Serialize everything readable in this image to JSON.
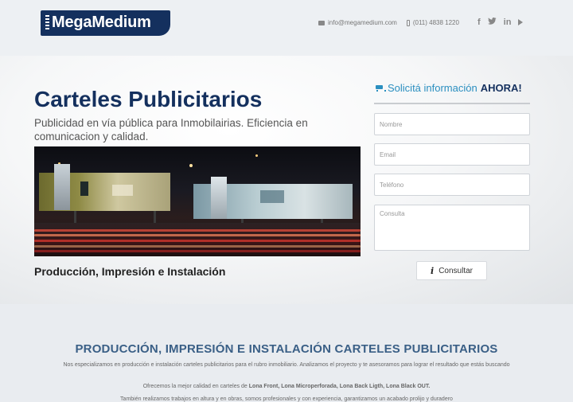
{
  "header": {
    "logo_text": "MegaMedium",
    "email": "info@megamedium.com",
    "phone": "(011) 4838 1220",
    "socials": [
      {
        "icon": "facebook-icon",
        "glyph": "f"
      },
      {
        "icon": "twitter-icon",
        "glyph": "t"
      },
      {
        "icon": "linkedin-icon",
        "glyph": "in"
      }
    ]
  },
  "hero": {
    "title": "Carteles Publicitarios",
    "subtitle": "Publicidad en vía pública para Inmobilairias. Eficiencia en comunicacion y calidad.",
    "caption": "Producción, Impresión e Instalación"
  },
  "form": {
    "title_prefix": "Solicitá información",
    "title_emphasis": "AHORA!",
    "name_placeholder": "Nombre",
    "email_placeholder": "Email",
    "phone_placeholder": "Teléfono",
    "message_placeholder": "Consulta",
    "submit_label": "Consultar"
  },
  "section": {
    "title": "PRODUCCIÓN, IMPRESIÓN E INSTALACIÓN CARTELES PUBLICITARIOS",
    "p1": "Nos especializamos en producción e instalación carteles publicitarios para el rubro inmobiliario. Analizamos el proyecto y te asesoramos para lograr el resultado que estás buscando",
    "p2_prefix": "Ofrecemos la mejor calidad en carteles de ",
    "p2_bold": "Lona Front, Lona Microperforada, Lona Back Ligth, Lona Black OUT.",
    "p3": "También realizamos trabajos en altura y en obras, somos profesionales y con experiencia, garantizamos un acabado prolijo y duradero"
  },
  "colors": {
    "brand": "#14305e",
    "accent": "#2b8fc0"
  }
}
